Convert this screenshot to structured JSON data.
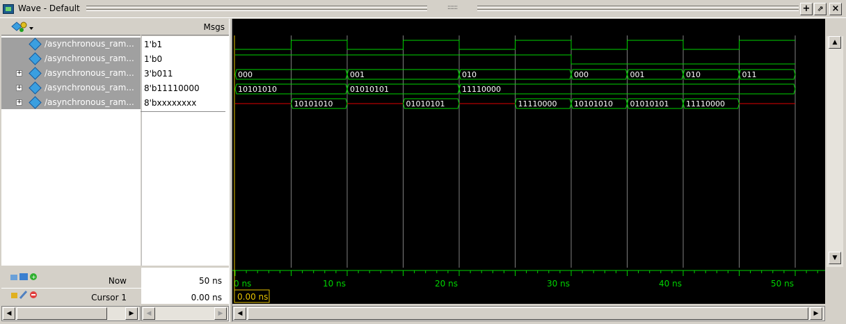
{
  "window": {
    "title": "Wave - Default",
    "grip_text": ":::::::",
    "buttons": {
      "zoom": "+",
      "undock": "⇗",
      "close": "×"
    }
  },
  "header": {
    "msgs_label": "Msgs"
  },
  "signals": [
    {
      "name": "/asynchronous_ram...",
      "value": "1'b1",
      "expandable": false
    },
    {
      "name": "/asynchronous_ram...",
      "value": "1'b0",
      "expandable": false
    },
    {
      "name": "/asynchronous_ram...",
      "value": "3'b011",
      "expandable": true
    },
    {
      "name": "/asynchronous_ram...",
      "value": "8'b11110000",
      "expandable": true
    },
    {
      "name": "/asynchronous_ram...",
      "value": "8'bxxxxxxxx",
      "expandable": true
    }
  ],
  "waves": {
    "clk_toggles_ns": [
      0,
      5,
      10,
      15,
      20,
      25,
      30,
      35,
      40,
      45,
      50
    ],
    "sig2_low_after_ns": 30,
    "addr": [
      {
        "start": 0,
        "end": 10,
        "label": "000"
      },
      {
        "start": 10,
        "end": 20,
        "label": "001"
      },
      {
        "start": 20,
        "end": 30,
        "label": "010"
      },
      {
        "start": 30,
        "end": 35,
        "label": "000"
      },
      {
        "start": 35,
        "end": 40,
        "label": "001"
      },
      {
        "start": 40,
        "end": 45,
        "label": "010"
      },
      {
        "start": 45,
        "end": 50,
        "label": "011"
      }
    ],
    "din": [
      {
        "start": 0,
        "end": 10,
        "label": "10101010"
      },
      {
        "start": 10,
        "end": 20,
        "label": "01010101"
      },
      {
        "start": 20,
        "end": 50,
        "label": "11110000"
      }
    ],
    "dout": [
      {
        "start": 0,
        "end": 5,
        "label": "",
        "x": true
      },
      {
        "start": 5,
        "end": 10,
        "label": "10101010"
      },
      {
        "start": 10,
        "end": 15,
        "label": "",
        "x": true
      },
      {
        "start": 15,
        "end": 20,
        "label": "01010101"
      },
      {
        "start": 20,
        "end": 25,
        "label": "",
        "x": true
      },
      {
        "start": 25,
        "end": 30,
        "label": "11110000"
      },
      {
        "start": 30,
        "end": 35,
        "label": "10101010"
      },
      {
        "start": 35,
        "end": 40,
        "label": "01010101"
      },
      {
        "start": 40,
        "end": 45,
        "label": "11110000"
      },
      {
        "start": 45,
        "end": 50,
        "label": "",
        "x": true
      }
    ]
  },
  "timeline": {
    "labels": [
      "0 ns",
      "10 ns",
      "20 ns",
      "30 ns",
      "40 ns",
      "50 ns"
    ],
    "label_times": [
      0,
      10,
      20,
      30,
      40,
      50
    ],
    "cursor_time_label": "0.00 ns"
  },
  "status": {
    "now_label": "Now",
    "now_value": "50 ns",
    "cursor_label": "Cursor 1",
    "cursor_value": "0.00 ns"
  },
  "colors": {
    "wave_green": "#00d400",
    "x_red": "#e00000",
    "cursor_yellow": "#e8c400",
    "grid": "#7f7f7f"
  }
}
